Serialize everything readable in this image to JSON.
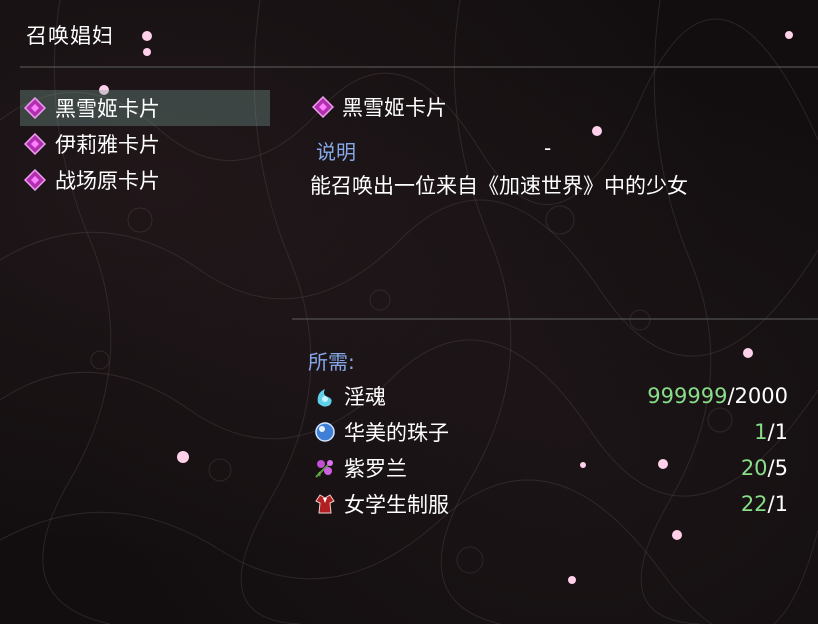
{
  "window": {
    "title": "召唤娼妇"
  },
  "cards": [
    {
      "label": "黑雪姬卡片",
      "selected": true,
      "icon": "card-icon"
    },
    {
      "label": "伊莉雅卡片",
      "selected": false,
      "icon": "card-icon"
    },
    {
      "label": "战场原卡片",
      "selected": false,
      "icon": "card-icon"
    }
  ],
  "detail": {
    "name": "黑雪姬卡片",
    "description_label": "说明",
    "description_dash": "-",
    "description": "能召唤出一位来自《加速世界》中的少女"
  },
  "requirements": {
    "label": "所需:",
    "items": [
      {
        "name": "淫魂",
        "have": "999999",
        "separator": "/",
        "need": "2000",
        "icon": "soul-icon"
      },
      {
        "name": "华美的珠子",
        "have": "1",
        "separator": "/",
        "need": "1",
        "icon": "orb-icon"
      },
      {
        "name": "紫罗兰",
        "have": "20",
        "separator": "/",
        "need": "5",
        "icon": "violet-icon"
      },
      {
        "name": "女学生制服",
        "have": "22",
        "separator": "/",
        "need": "1",
        "icon": "uniform-icon"
      }
    ]
  },
  "colors": {
    "accent_label": "#86a8e8",
    "have_amount": "#88dd88",
    "selection": "#5f7f78",
    "card_icon": "#c040c0"
  }
}
